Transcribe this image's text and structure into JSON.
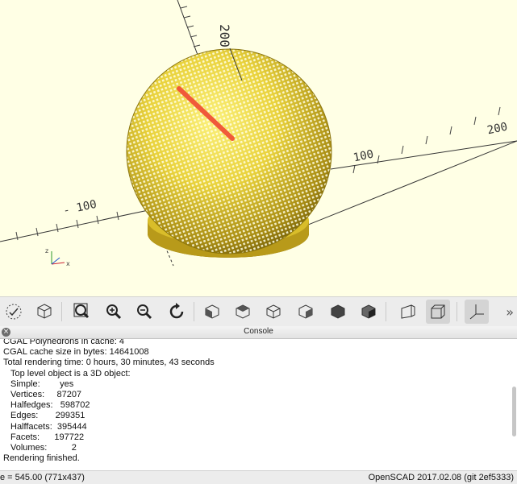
{
  "viewport": {
    "axis_labels": [
      "200",
      "100",
      "- 100",
      "200"
    ]
  },
  "toolbar": {
    "buttons": [
      {
        "name": "preview-button-icon"
      },
      {
        "name": "render-button-icon"
      },
      {
        "name": "view-all-icon"
      },
      {
        "name": "zoom-in-icon"
      },
      {
        "name": "zoom-out-icon"
      },
      {
        "name": "reset-view-icon"
      },
      {
        "name": "view-right-icon"
      },
      {
        "name": "view-top-icon"
      },
      {
        "name": "view-bottom-icon"
      },
      {
        "name": "view-left-icon"
      },
      {
        "name": "view-front-icon"
      },
      {
        "name": "view-back-icon"
      },
      {
        "name": "perspective-icon"
      },
      {
        "name": "orthogonal-icon"
      },
      {
        "name": "show-axes-icon"
      }
    ],
    "more": "»"
  },
  "console": {
    "title": "Console",
    "close": "×",
    "lines": [
      {
        "text": "CGAL Polyhedrons in cache: 4",
        "indent": false
      },
      {
        "text": "CGAL cache size in bytes: 14641008",
        "indent": false
      },
      {
        "text": "Total rendering time: 0 hours, 30 minutes, 43 seconds",
        "indent": false
      },
      {
        "text": "Top level object is a 3D object:",
        "indent": true
      },
      {
        "text": "Simple:        yes",
        "indent": true
      },
      {
        "text": "Vertices:     87207",
        "indent": true
      },
      {
        "text": "Halfedges:   598702",
        "indent": true
      },
      {
        "text": "Edges:       299351",
        "indent": true
      },
      {
        "text": "Halffacets:  395444",
        "indent": true
      },
      {
        "text": "Facets:      197722",
        "indent": true
      },
      {
        "text": "Volumes:          2",
        "indent": true
      },
      {
        "text": "Rendering finished.",
        "indent": false
      }
    ]
  },
  "status": {
    "left": "e = 545.00 (771x437)",
    "right": "OpenSCAD 2017.02.08 (git 2ef5333)"
  },
  "colors": {
    "sphere": "#e3c92f",
    "arrow": "#f05a3a",
    "viewport_bg": "#ffffe5"
  }
}
